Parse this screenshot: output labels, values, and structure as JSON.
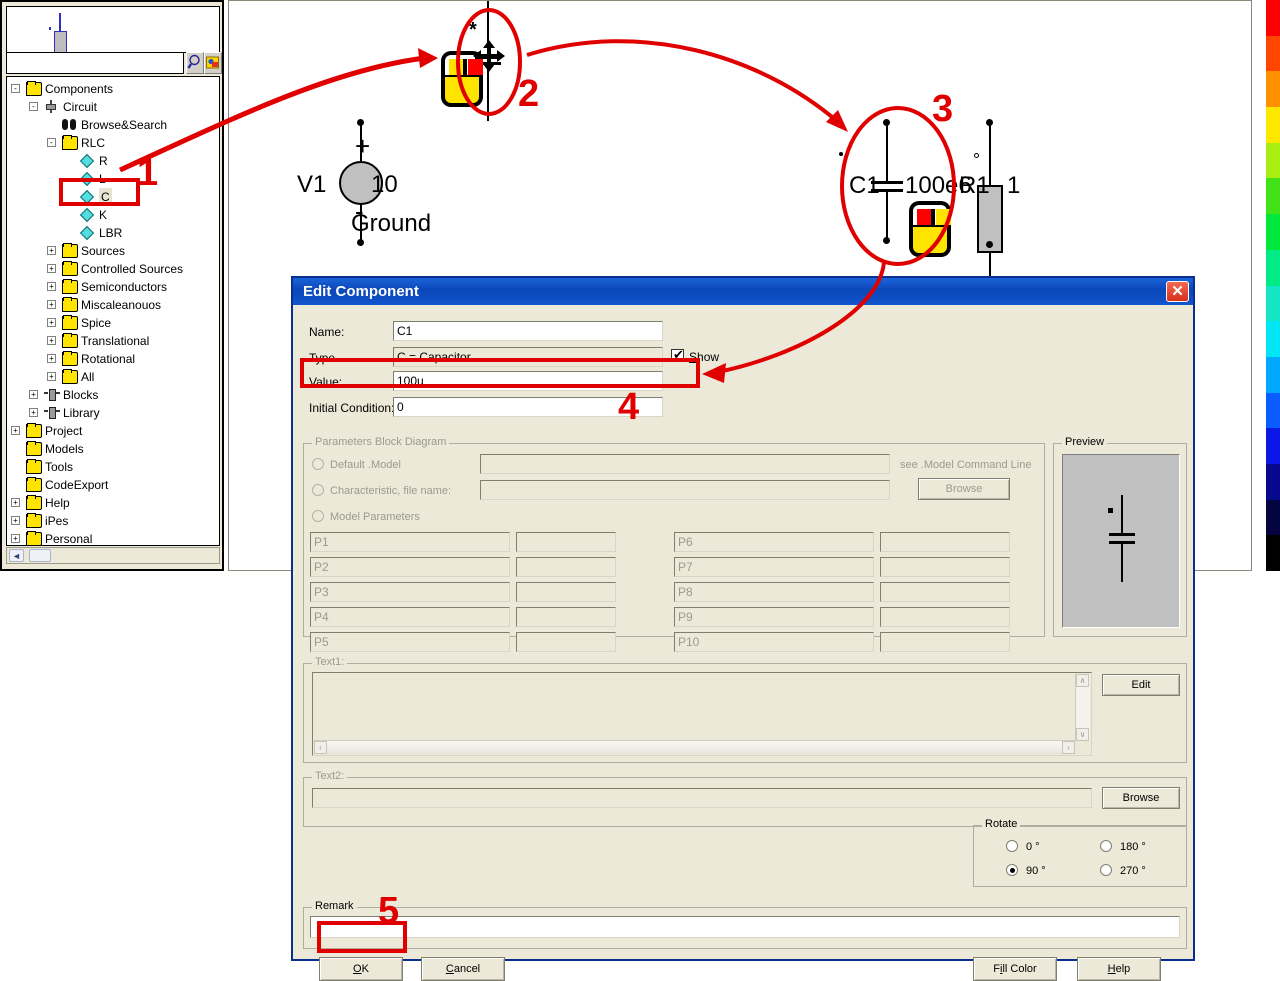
{
  "app": {
    "tree_panel": {
      "search": {
        "value": "",
        "placeholder": ""
      },
      "search_icon": "magnifier-icon",
      "browse_icon": "image-browse-icon",
      "preview_caption": "component-thumbnail"
    },
    "tree": [
      {
        "label": "Components",
        "depth": 0,
        "icon": "folder",
        "expander": "-"
      },
      {
        "label": "Circuit",
        "depth": 1,
        "icon": "component",
        "expander": "-"
      },
      {
        "label": "Browse&Search",
        "depth": 2,
        "icon": "binocular",
        "expander": ""
      },
      {
        "label": "RLC",
        "depth": 2,
        "icon": "folder",
        "expander": "-"
      },
      {
        "label": "R",
        "depth": 3,
        "icon": "diamond",
        "expander": ""
      },
      {
        "label": "L",
        "depth": 3,
        "icon": "diamond",
        "expander": ""
      },
      {
        "label": "C",
        "depth": 3,
        "icon": "diamond",
        "expander": "",
        "selected": true
      },
      {
        "label": "K",
        "depth": 3,
        "icon": "diamond",
        "expander": ""
      },
      {
        "label": "LBR",
        "depth": 3,
        "icon": "diamond",
        "expander": ""
      },
      {
        "label": "Sources",
        "depth": 2,
        "icon": "folder",
        "expander": "+"
      },
      {
        "label": "Controlled Sources",
        "depth": 2,
        "icon": "folder",
        "expander": "+"
      },
      {
        "label": "Semiconductors",
        "depth": 2,
        "icon": "folder",
        "expander": "+"
      },
      {
        "label": "Miscaleanouos",
        "depth": 2,
        "icon": "folder",
        "expander": "+"
      },
      {
        "label": "Spice",
        "depth": 2,
        "icon": "folder",
        "expander": "+"
      },
      {
        "label": "Translational",
        "depth": 2,
        "icon": "folder",
        "expander": "+"
      },
      {
        "label": "Rotational",
        "depth": 2,
        "icon": "folder",
        "expander": "+"
      },
      {
        "label": "All",
        "depth": 2,
        "icon": "folder",
        "expander": "+"
      },
      {
        "label": "Blocks",
        "depth": 1,
        "icon": "block",
        "expander": "+"
      },
      {
        "label": "Library",
        "depth": 1,
        "icon": "block",
        "expander": "+"
      },
      {
        "label": "Project",
        "depth": 0,
        "icon": "folder",
        "expander": "+"
      },
      {
        "label": "Models",
        "depth": 0,
        "icon": "folder",
        "expander": ""
      },
      {
        "label": "Tools",
        "depth": 0,
        "icon": "folder",
        "expander": ""
      },
      {
        "label": "CodeExport",
        "depth": 0,
        "icon": "folder",
        "expander": ""
      },
      {
        "label": "Help",
        "depth": 0,
        "icon": "folder",
        "expander": "+"
      },
      {
        "label": "iPes",
        "depth": 0,
        "icon": "folder",
        "expander": "+"
      },
      {
        "label": "Personal",
        "depth": 0,
        "icon": "folder",
        "expander": "+"
      }
    ],
    "schematic": {
      "v1_name": "V1",
      "v1_value": "10",
      "v1_plus": "+",
      "v1_minus": "-",
      "ground_label": "Ground",
      "c1_name": "C1",
      "c1_value": "100e6",
      "r1_name": "R1",
      "r1_value": "1",
      "cursor_star": "*",
      "scroll_up": "▲",
      "scroll_down": "▼",
      "scroll_left": "◄"
    },
    "palette_colors": [
      "#ff0000",
      "#ff4500",
      "#ff9000",
      "#ffe800",
      "#a8ee10",
      "#41e318",
      "#00e83c",
      "#00eb85",
      "#14e6c4",
      "#00e6f5",
      "#00a8ff",
      "#0a5cff",
      "#0a17e6",
      "#06098c",
      "#04043f",
      "#000000"
    ],
    "annotations": {
      "steps": [
        "1",
        "2",
        "3",
        "4",
        "5"
      ]
    }
  },
  "dialog": {
    "title": "Edit Component",
    "close_icon": "close-icon",
    "fields": {
      "name_label": "Name:",
      "name_value": "C1",
      "type_label": "Type",
      "type_value": "C = Capacitor",
      "show_label": "Show",
      "show_checked": true,
      "value_label": "Value:",
      "value_value": "100u",
      "initial_condition_label": "Initial Condition:",
      "initial_condition_value": "0"
    },
    "params_group": {
      "caption": "Parameters Block Diagram",
      "default_model_label": "Default .Model",
      "default_model_value": "",
      "see_model_hint": "see .Model Command Line",
      "characteristic_label": "Characteristic, file name:",
      "characteristic_value": "",
      "browse_label": "Browse",
      "model_parameters_label": "Model Parameters",
      "selected_radio": "none",
      "rows_left": [
        {
          "name": "P1",
          "value": ""
        },
        {
          "name": "P2",
          "value": ""
        },
        {
          "name": "P3",
          "value": ""
        },
        {
          "name": "P4",
          "value": ""
        },
        {
          "name": "P5",
          "value": ""
        }
      ],
      "rows_right": [
        {
          "name": "P6",
          "value": ""
        },
        {
          "name": "P7",
          "value": ""
        },
        {
          "name": "P8",
          "value": ""
        },
        {
          "name": "P9",
          "value": ""
        },
        {
          "name": "P10",
          "value": ""
        }
      ]
    },
    "preview": {
      "caption": "Preview",
      "symbol": "capacitor-vertical"
    },
    "text1": {
      "caption": "Text1:",
      "value": "",
      "edit_label": "Edit"
    },
    "text2": {
      "caption": "Text2:",
      "value": "",
      "browse_label": "Browse"
    },
    "rotate": {
      "caption": "Rotate",
      "options": [
        "0 °",
        "90 °",
        "180 °",
        "270 °"
      ],
      "selected": "90 °"
    },
    "remark": {
      "caption": "Remark",
      "value": ""
    },
    "buttons": {
      "ok": "OK",
      "cancel": "Cancel",
      "fill_color": "Fill Color",
      "help": "Help"
    }
  }
}
